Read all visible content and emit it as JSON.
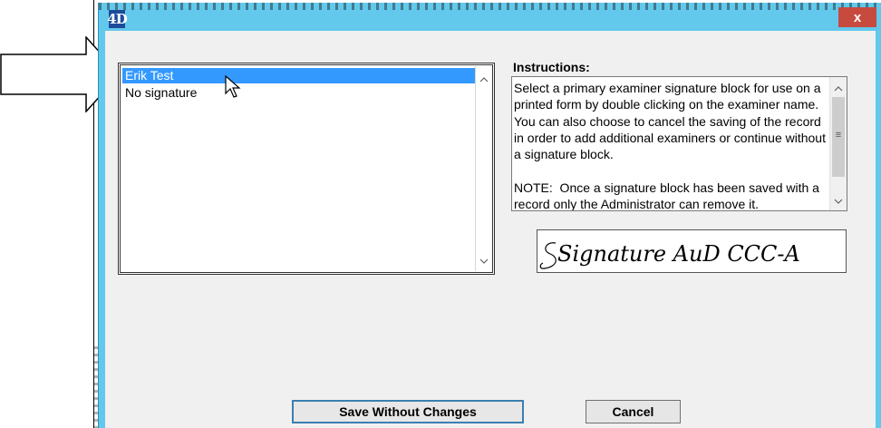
{
  "window": {
    "app_icon": "4D",
    "close_glyph": "x"
  },
  "signature_list": {
    "items": [
      {
        "label": "Erik Test",
        "selected": true
      },
      {
        "label": "No signature",
        "selected": false
      }
    ]
  },
  "instructions": {
    "label": "Instructions:",
    "text": "Select a primary examiner signature block for use on a printed form by double clicking on the examiner name.  You can also choose to cancel the saving of the record in order to add additional examiners or continue without a signature block.\n\nNOTE:  Once a signature block has been saved with a record only the Administrator can remove it."
  },
  "signature_preview": {
    "text": "Signature AuD CCC-A"
  },
  "buttons": {
    "save_label": "Save Without Changes",
    "cancel_label": "Cancel"
  },
  "colors": {
    "window_frame": "#62c8ec",
    "selection": "#3399ff",
    "close_button": "#c74a3f",
    "app_icon_bg": "#1c4c9a"
  },
  "icons": {
    "pointer_arrow": "outline-arrow-right",
    "mouse_cursor": "arrow-cursor",
    "scroll_up": "chevron-up",
    "scroll_down": "chevron-down",
    "scroll_grip": "grip-lines"
  }
}
